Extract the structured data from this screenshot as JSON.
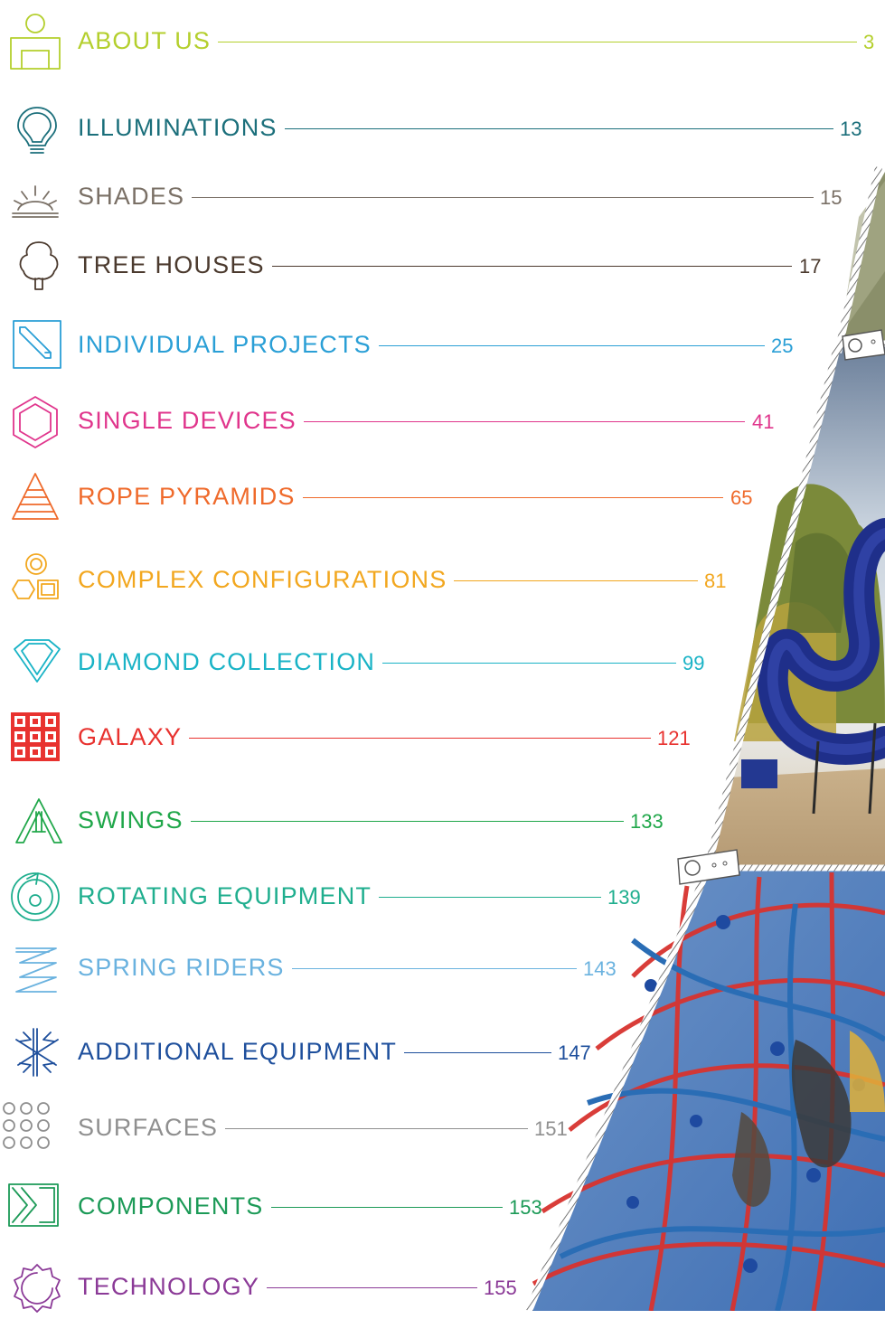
{
  "toc": [
    {
      "label": "ABOUT US",
      "page": "3",
      "color": "#b4cf2d",
      "icon": "person-icon"
    },
    {
      "label": "ILLUMINATIONS",
      "page": "13",
      "color": "#1b6f7b",
      "icon": "lightbulb-icon"
    },
    {
      "label": "SHADES",
      "page": "15",
      "color": "#7a7066",
      "icon": "sun-shade-icon"
    },
    {
      "label": "TREE HOUSES",
      "page": "17",
      "color": "#4b3a2e",
      "icon": "tree-icon"
    },
    {
      "label": "INDIVIDUAL PROJECTS",
      "page": "25",
      "color": "#2a9fd6",
      "icon": "pencil-icon"
    },
    {
      "label": "SINGLE DEVICES",
      "page": "41",
      "color": "#e0358c",
      "icon": "hexagon-icon"
    },
    {
      "label": "ROPE PYRAMIDS",
      "page": "65",
      "color": "#ef6a2b",
      "icon": "pyramid-icon"
    },
    {
      "label": "COMPLEX CONFIGURATIONS",
      "page": "81",
      "color": "#f2a71f",
      "icon": "complex-shapes-icon"
    },
    {
      "label": "DIAMOND COLLECTION",
      "page": "99",
      "color": "#19b3c6",
      "icon": "diamond-icon"
    },
    {
      "label": "GALAXY",
      "page": "121",
      "color": "#e8322f",
      "icon": "grid-icon"
    },
    {
      "label": "SWINGS",
      "page": "133",
      "color": "#20a74a",
      "icon": "swing-frame-icon"
    },
    {
      "label": "ROTATING EQUIPMENT",
      "page": "139",
      "color": "#1fae8e",
      "icon": "rotation-icon"
    },
    {
      "label": "SPRING RIDERS",
      "page": "143",
      "color": "#6ab2df",
      "icon": "spring-icon"
    },
    {
      "label": "ADDITIONAL EQUIPMENT",
      "page": "147",
      "color": "#1e4f9c",
      "icon": "snowflake-icon"
    },
    {
      "label": "SURFACES",
      "page": "151",
      "color": "#8f8f8f",
      "icon": "dots-icon"
    },
    {
      "label": "COMPONENTS",
      "page": "153",
      "color": "#1c9a57",
      "icon": "components-icon"
    },
    {
      "label": "TECHNOLOGY",
      "page": "155",
      "color": "#8b3a97",
      "icon": "gear-icon"
    }
  ]
}
